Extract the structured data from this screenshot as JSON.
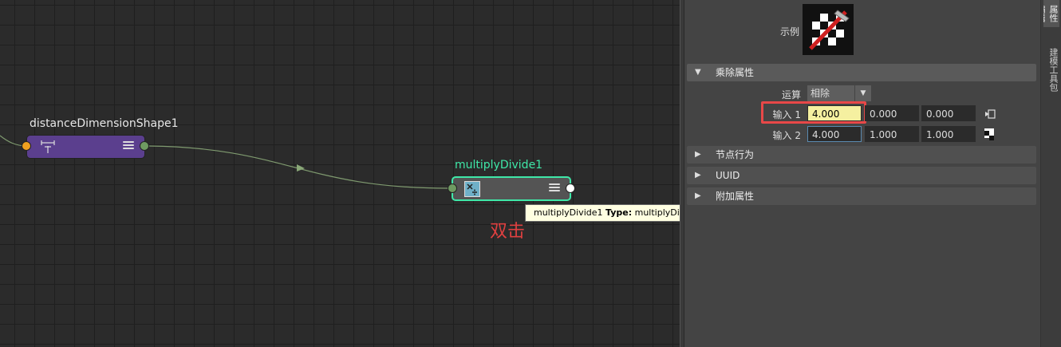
{
  "graph": {
    "node_a": {
      "name": "distanceDimensionShape1"
    },
    "node_b": {
      "name": "multiplyDivide1"
    },
    "tooltip": {
      "name": "multiplyDivide1",
      "type_label": "Type:",
      "type_value": "multiplyDivide"
    },
    "annotation": "双击"
  },
  "colors": {
    "node_a_fill": "#5b3f8e",
    "node_b_fill": "#545454",
    "node_b_border": "#3fe8a8",
    "annotation": "#e04040",
    "highlight_field": "#f5f0a0"
  },
  "panel": {
    "sample_label": "示例",
    "sections": {
      "multiply": {
        "title": "乘除属性"
      },
      "node_behavior": {
        "title": "节点行为"
      },
      "uuid": {
        "title": "UUID"
      },
      "extra": {
        "title": "附加属性"
      }
    },
    "operation": {
      "label": "运算",
      "value": "相除"
    },
    "input1": {
      "label": "输入 1",
      "x": "4.000",
      "y": "0.000",
      "z": "0.000"
    },
    "input2": {
      "label": "输入 2",
      "x": "4.000",
      "y": "1.000",
      "z": "1.000"
    }
  },
  "side_tabs": {
    "tab1": "属性编辑器",
    "tab2": "建模工具包"
  }
}
